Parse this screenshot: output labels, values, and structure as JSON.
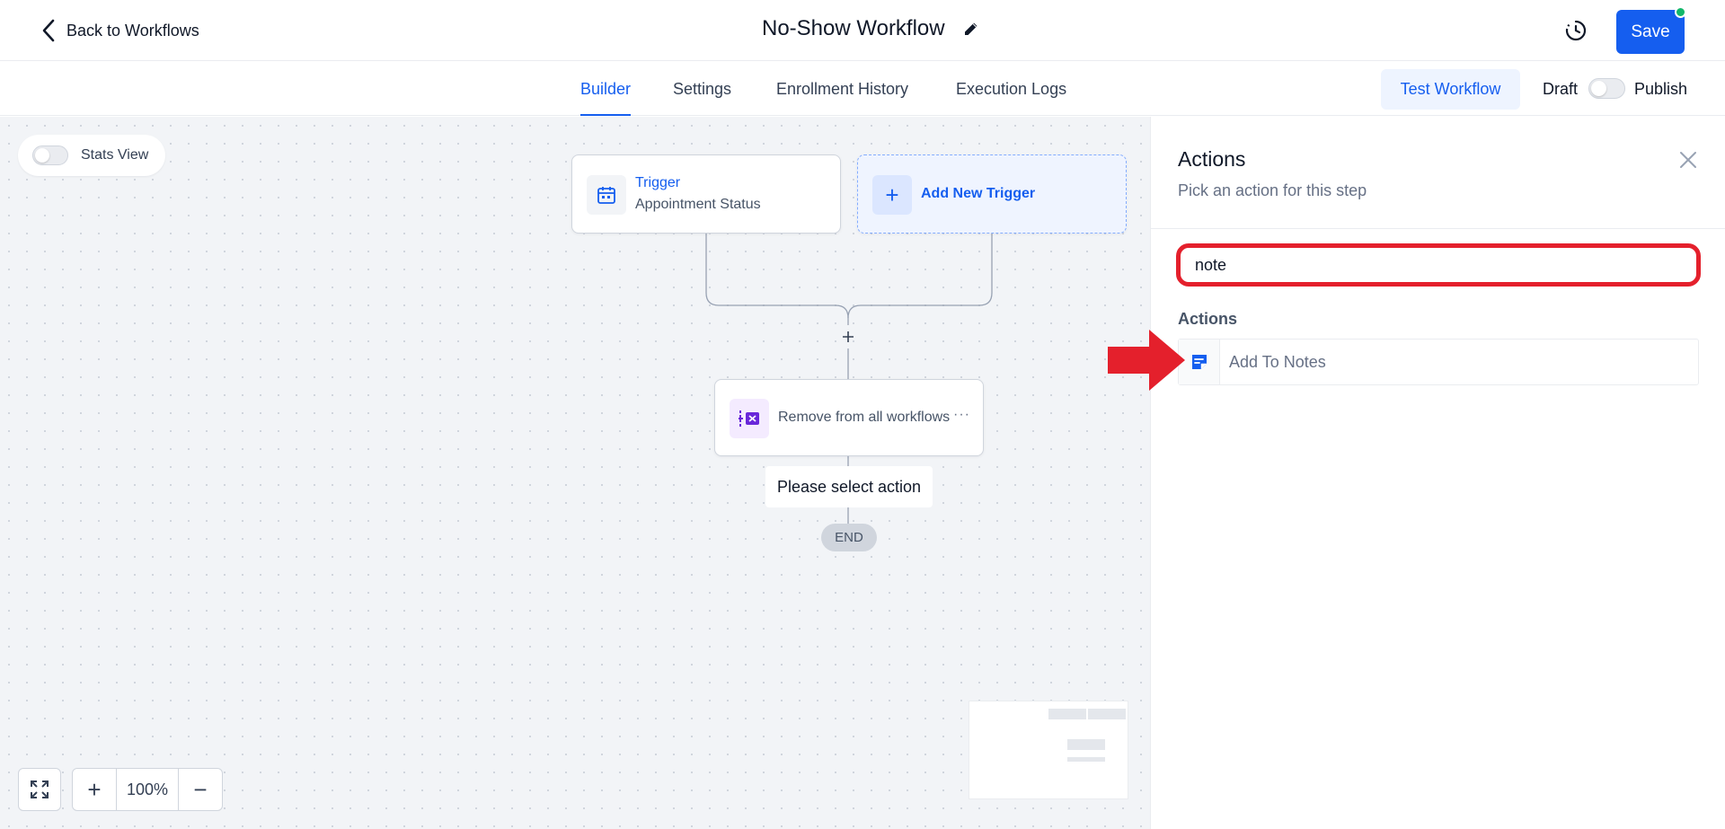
{
  "header": {
    "back_label": "Back to Workflows",
    "title": "No-Show Workflow",
    "save_label": "Save"
  },
  "tabs": [
    {
      "label": "Builder",
      "active": true
    },
    {
      "label": "Settings",
      "active": false
    },
    {
      "label": "Enrollment History",
      "active": false
    },
    {
      "label": "Execution Logs",
      "active": false
    }
  ],
  "toolbar": {
    "test_label": "Test Workflow",
    "draft_label": "Draft",
    "publish_label": "Publish",
    "published": false
  },
  "canvas": {
    "stats_label": "Stats View",
    "stats_enabled": false,
    "trigger": {
      "title": "Trigger",
      "subtitle": "Appointment Status"
    },
    "add_trigger_label": "Add New Trigger",
    "action_node_label": "Remove from all workflows",
    "placeholder_label": "Please select action",
    "end_label": "END",
    "zoom_level": "100%"
  },
  "panel": {
    "title": "Actions",
    "subtitle": "Pick an action for this step",
    "search_value": "note",
    "section_label": "Actions",
    "results": [
      {
        "label": "Add To Notes",
        "icon": "note-icon"
      }
    ]
  },
  "colors": {
    "accent": "#155eef",
    "highlight": "#e4202c",
    "status_online": "#12b76a"
  }
}
